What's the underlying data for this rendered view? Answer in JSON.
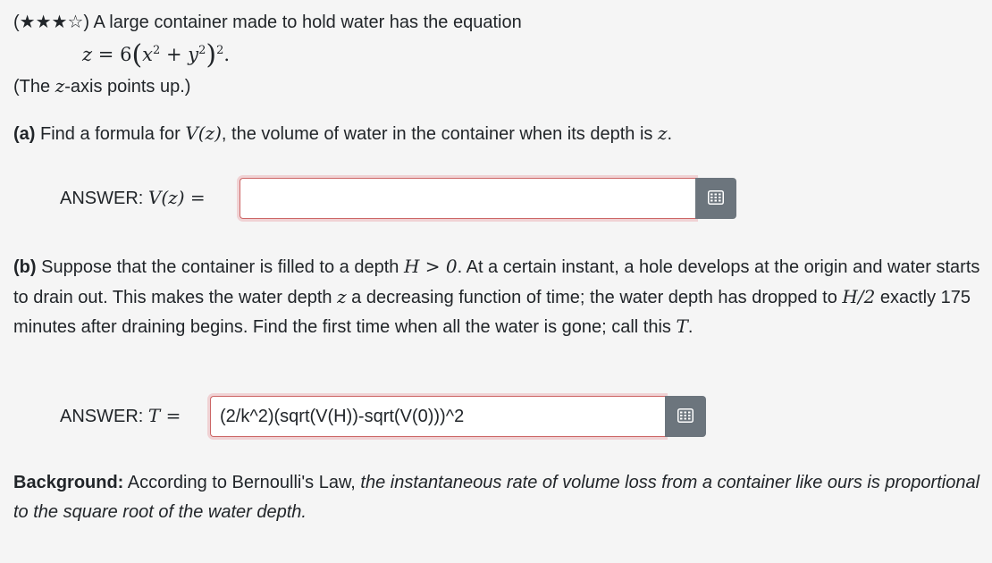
{
  "rating": "(★★★☆)",
  "intro": "A large container made to hold water has the equation",
  "equation": {
    "lhs": "z",
    "eq": "=",
    "coef": "6",
    "x": "x",
    "y": "y",
    "exp": "2",
    "plus": "+",
    "end": "."
  },
  "note": {
    "pre": "(The ",
    "var": "z",
    "post": "-axis points up.)"
  },
  "part_a": {
    "label": "(a)",
    "text_pre": "Find a formula for ",
    "func": "V(z)",
    "text_post": ", the volume of water in the container when its depth is ",
    "var": "z",
    "end": ".",
    "answer_label": "ANSWER:",
    "answer_math": "V(z) =",
    "answer_value": ""
  },
  "part_b": {
    "label": "(b)",
    "t1": "Suppose that the container is filled to a depth ",
    "m1": "H > 0",
    "t2": ". At a certain instant, a hole develops at the origin and water starts to drain out. This makes the water depth ",
    "m2": "z",
    "t3": " a decreasing function of time; the water depth has dropped to ",
    "m3": "H/2",
    "t4": " exactly 175 minutes after draining begins. Find the first time when all the water is gone; call this ",
    "m4": "T",
    "t5": ".",
    "answer_label": "ANSWER:",
    "answer_math": "T =",
    "answer_value": "(2/k^2)(sqrt(V(H))-sqrt(V(0)))^2"
  },
  "background": {
    "label": "Background:",
    "text": " According to Bernoulli's Law, ",
    "italic": "the instantaneous rate of volume loss from a container like ours is proportional to the square root of the water depth."
  },
  "icons": {
    "math_editor": "grid-keyboard-icon"
  },
  "colors": {
    "button": "#6c757d",
    "invalid_border": "#cc6666",
    "background": "#f5f5f5"
  }
}
